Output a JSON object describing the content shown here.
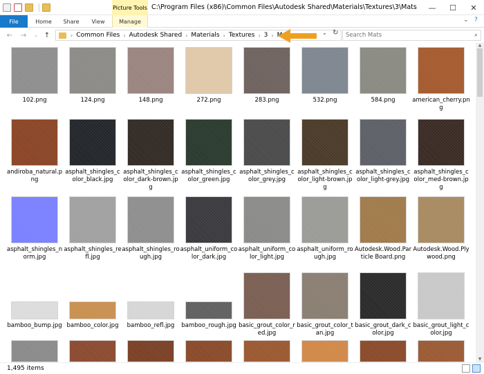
{
  "titlebar": {
    "path": "C:\\Program Files (x86)\\Common Files\\Autodesk Shared\\Materials\\Textures\\3\\Mats",
    "contextual_tab": "Picture Tools",
    "controls": {
      "minimize": "—",
      "maximize": "☐",
      "close": "✕"
    }
  },
  "ribbon": {
    "tabs": [
      "File",
      "Home",
      "Share",
      "View",
      "Manage"
    ],
    "collapse_glyph": "⌄",
    "help_glyph": "?"
  },
  "nav": {
    "back": "←",
    "forward": "→",
    "recent": "⌄",
    "up": "↑"
  },
  "address": {
    "crumbs": [
      "Common Files",
      "Autodesk Shared",
      "Materials",
      "Textures",
      "3",
      "Mats"
    ],
    "separator": "›",
    "dropdown_glyph": "⌄",
    "refresh_glyph": "↻"
  },
  "search": {
    "placeholder": "Search Mats",
    "icon_glyph": "⌕"
  },
  "arrow_color": "#f0a020",
  "files": [
    {
      "name": "102.png",
      "color": "#8e8e8e"
    },
    {
      "name": "124.png",
      "color": "#8c8a86"
    },
    {
      "name": "148.png",
      "color": "#9a8480"
    },
    {
      "name": "272.png",
      "color": "#e0c8a8"
    },
    {
      "name": "283.png",
      "color": "#6e625e"
    },
    {
      "name": "532.png",
      "color": "#7e8690"
    },
    {
      "name": "584.png",
      "color": "#8a8a82"
    },
    {
      "name": "american_cherry.png",
      "color": "#a55a2e"
    },
    {
      "name": "andiroba_natural.png",
      "color": "#8a4426"
    },
    {
      "name": "asphalt_shingles_color_black.jpg",
      "color": "#22262a"
    },
    {
      "name": "asphalt_shingles_color_dark-brown.jpg",
      "color": "#322a24"
    },
    {
      "name": "asphalt_shingles_color_green.jpg",
      "color": "#2a3a2e"
    },
    {
      "name": "asphalt_shingles_color_grey.jpg",
      "color": "#4a4a4a"
    },
    {
      "name": "asphalt_shingles_color_light-brown.jpg",
      "color": "#4a3a28"
    },
    {
      "name": "asphalt_shingles_color_light-grey.jpg",
      "color": "#5c6066"
    },
    {
      "name": "asphalt_shingles_color_med-brown.jpg",
      "color": "#3a2a24"
    },
    {
      "name": "asphalt_shingles_norm.jpg",
      "color": "#7a80ff"
    },
    {
      "name": "asphalt_shingles_refl.jpg",
      "color": "#a0a0a0"
    },
    {
      "name": "asphalt_shingles_rough.jpg",
      "color": "#8e8e8e"
    },
    {
      "name": "asphalt_uniform_color_dark.jpg",
      "color": "#3a3a3e"
    },
    {
      "name": "asphalt_uniform_color_light.jpg",
      "color": "#8a8a88"
    },
    {
      "name": "asphalt_uniform_rough.jpg",
      "color": "#9a9a96"
    },
    {
      "name": "Autodesk.Wood.Particle Board.png",
      "color": "#a07a4a"
    },
    {
      "name": "Autodesk.Wood.Plywood.png",
      "color": "#a88a60"
    },
    {
      "name": "bamboo_bump.jpg",
      "color": "#dcdcdc"
    },
    {
      "name": "bamboo_color.jpg",
      "color": "#c89050"
    },
    {
      "name": "bamboo_refl.jpg",
      "color": "#d6d6d6"
    },
    {
      "name": "bamboo_rough.jpg",
      "color": "#606060"
    },
    {
      "name": "basic_grout_color_red.jpg",
      "color": "#7a5e52"
    },
    {
      "name": "basic_grout_color_tan.jpg",
      "color": "#8a7e72"
    },
    {
      "name": "basic_grout_dark_color.jpg",
      "color": "#2a2a2a"
    },
    {
      "name": "basic_grout_light_color.jpg",
      "color": "#c8c8c8"
    },
    {
      "name": "",
      "color": "#8a8a8a"
    },
    {
      "name": "",
      "color": "#8a4a30"
    },
    {
      "name": "",
      "color": "#7a4026"
    },
    {
      "name": "",
      "color": "#8a4a2a"
    },
    {
      "name": "",
      "color": "#9a5830"
    },
    {
      "name": "",
      "color": "#d08848"
    },
    {
      "name": "",
      "color": "#8a4a2a"
    },
    {
      "name": "",
      "color": "#9a5a34"
    }
  ],
  "status": {
    "count": "1,495 items"
  }
}
